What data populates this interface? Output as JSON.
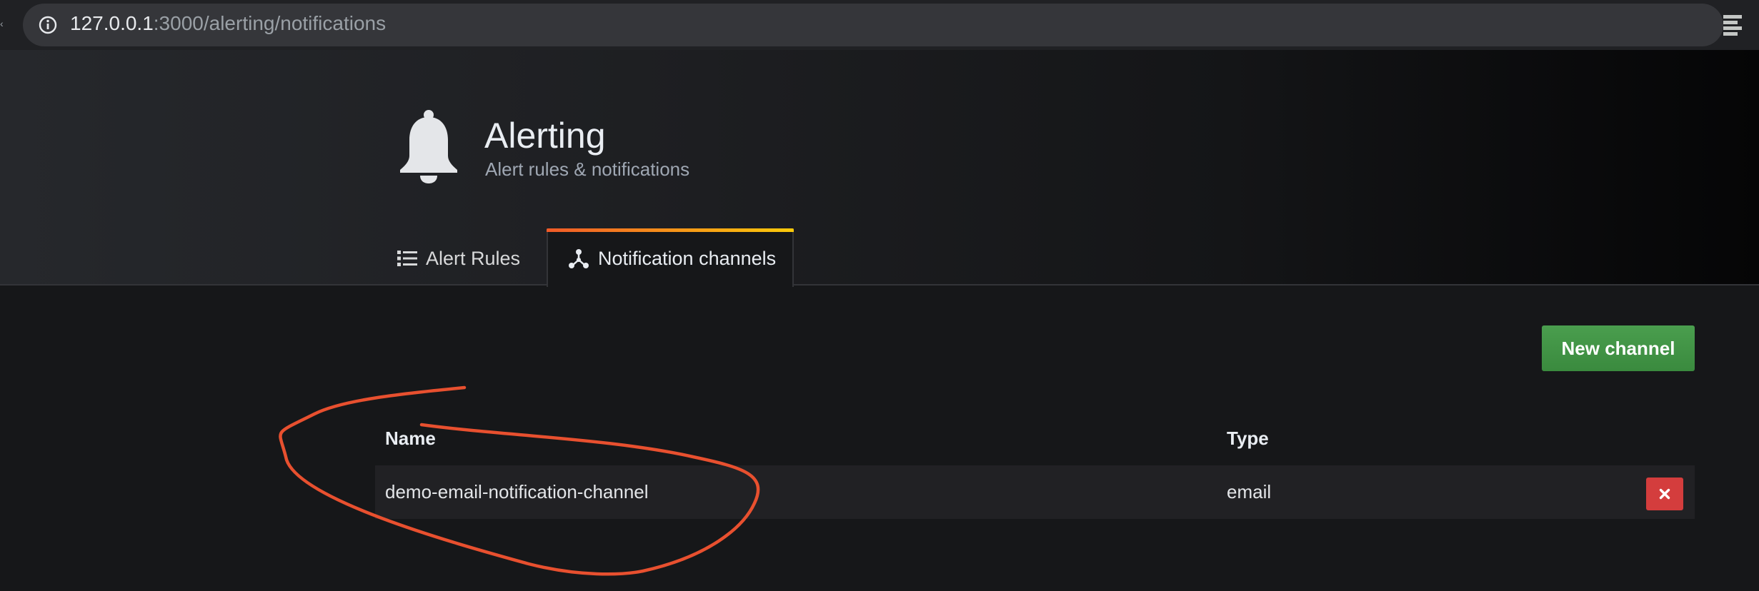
{
  "browser": {
    "url_host": "127.0.0.1",
    "url_rest": ":3000/alerting/notifications"
  },
  "header": {
    "title": "Alerting",
    "subtitle": "Alert rules & notifications"
  },
  "tabs": [
    {
      "label": "Alert Rules",
      "icon": "list-icon",
      "active": false
    },
    {
      "label": "Notification channels",
      "icon": "share-nodes-icon",
      "active": true
    }
  ],
  "actions": {
    "new_channel_label": "New channel"
  },
  "table": {
    "columns": [
      "Name",
      "Type"
    ],
    "rows": [
      {
        "name": "demo-email-notification-channel",
        "type": "email"
      }
    ]
  },
  "colors": {
    "accent_green": "#3d9141",
    "danger_red": "#d43d3d",
    "annotation_stroke": "#e8502f",
    "tab_gradient_start": "#f05a28",
    "tab_gradient_end": "#fbca0a"
  }
}
